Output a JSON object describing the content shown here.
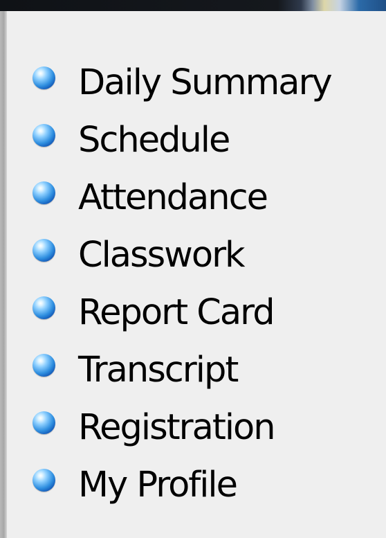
{
  "menu": {
    "items": [
      {
        "label": "Daily Summary",
        "icon": "blue-bullet-icon"
      },
      {
        "label": "Schedule",
        "icon": "blue-bullet-icon"
      },
      {
        "label": "Attendance",
        "icon": "blue-bullet-icon"
      },
      {
        "label": "Classwork",
        "icon": "blue-bullet-icon"
      },
      {
        "label": "Report Card",
        "icon": "blue-bullet-icon"
      },
      {
        "label": "Transcript",
        "icon": "blue-bullet-icon"
      },
      {
        "label": "Registration",
        "icon": "blue-bullet-icon"
      },
      {
        "label": "My Profile",
        "icon": "blue-bullet-icon"
      }
    ]
  },
  "colors": {
    "background": "#efefef",
    "text": "#000000",
    "bullet": "#2f8fe0",
    "top_bar": "#15181d"
  }
}
